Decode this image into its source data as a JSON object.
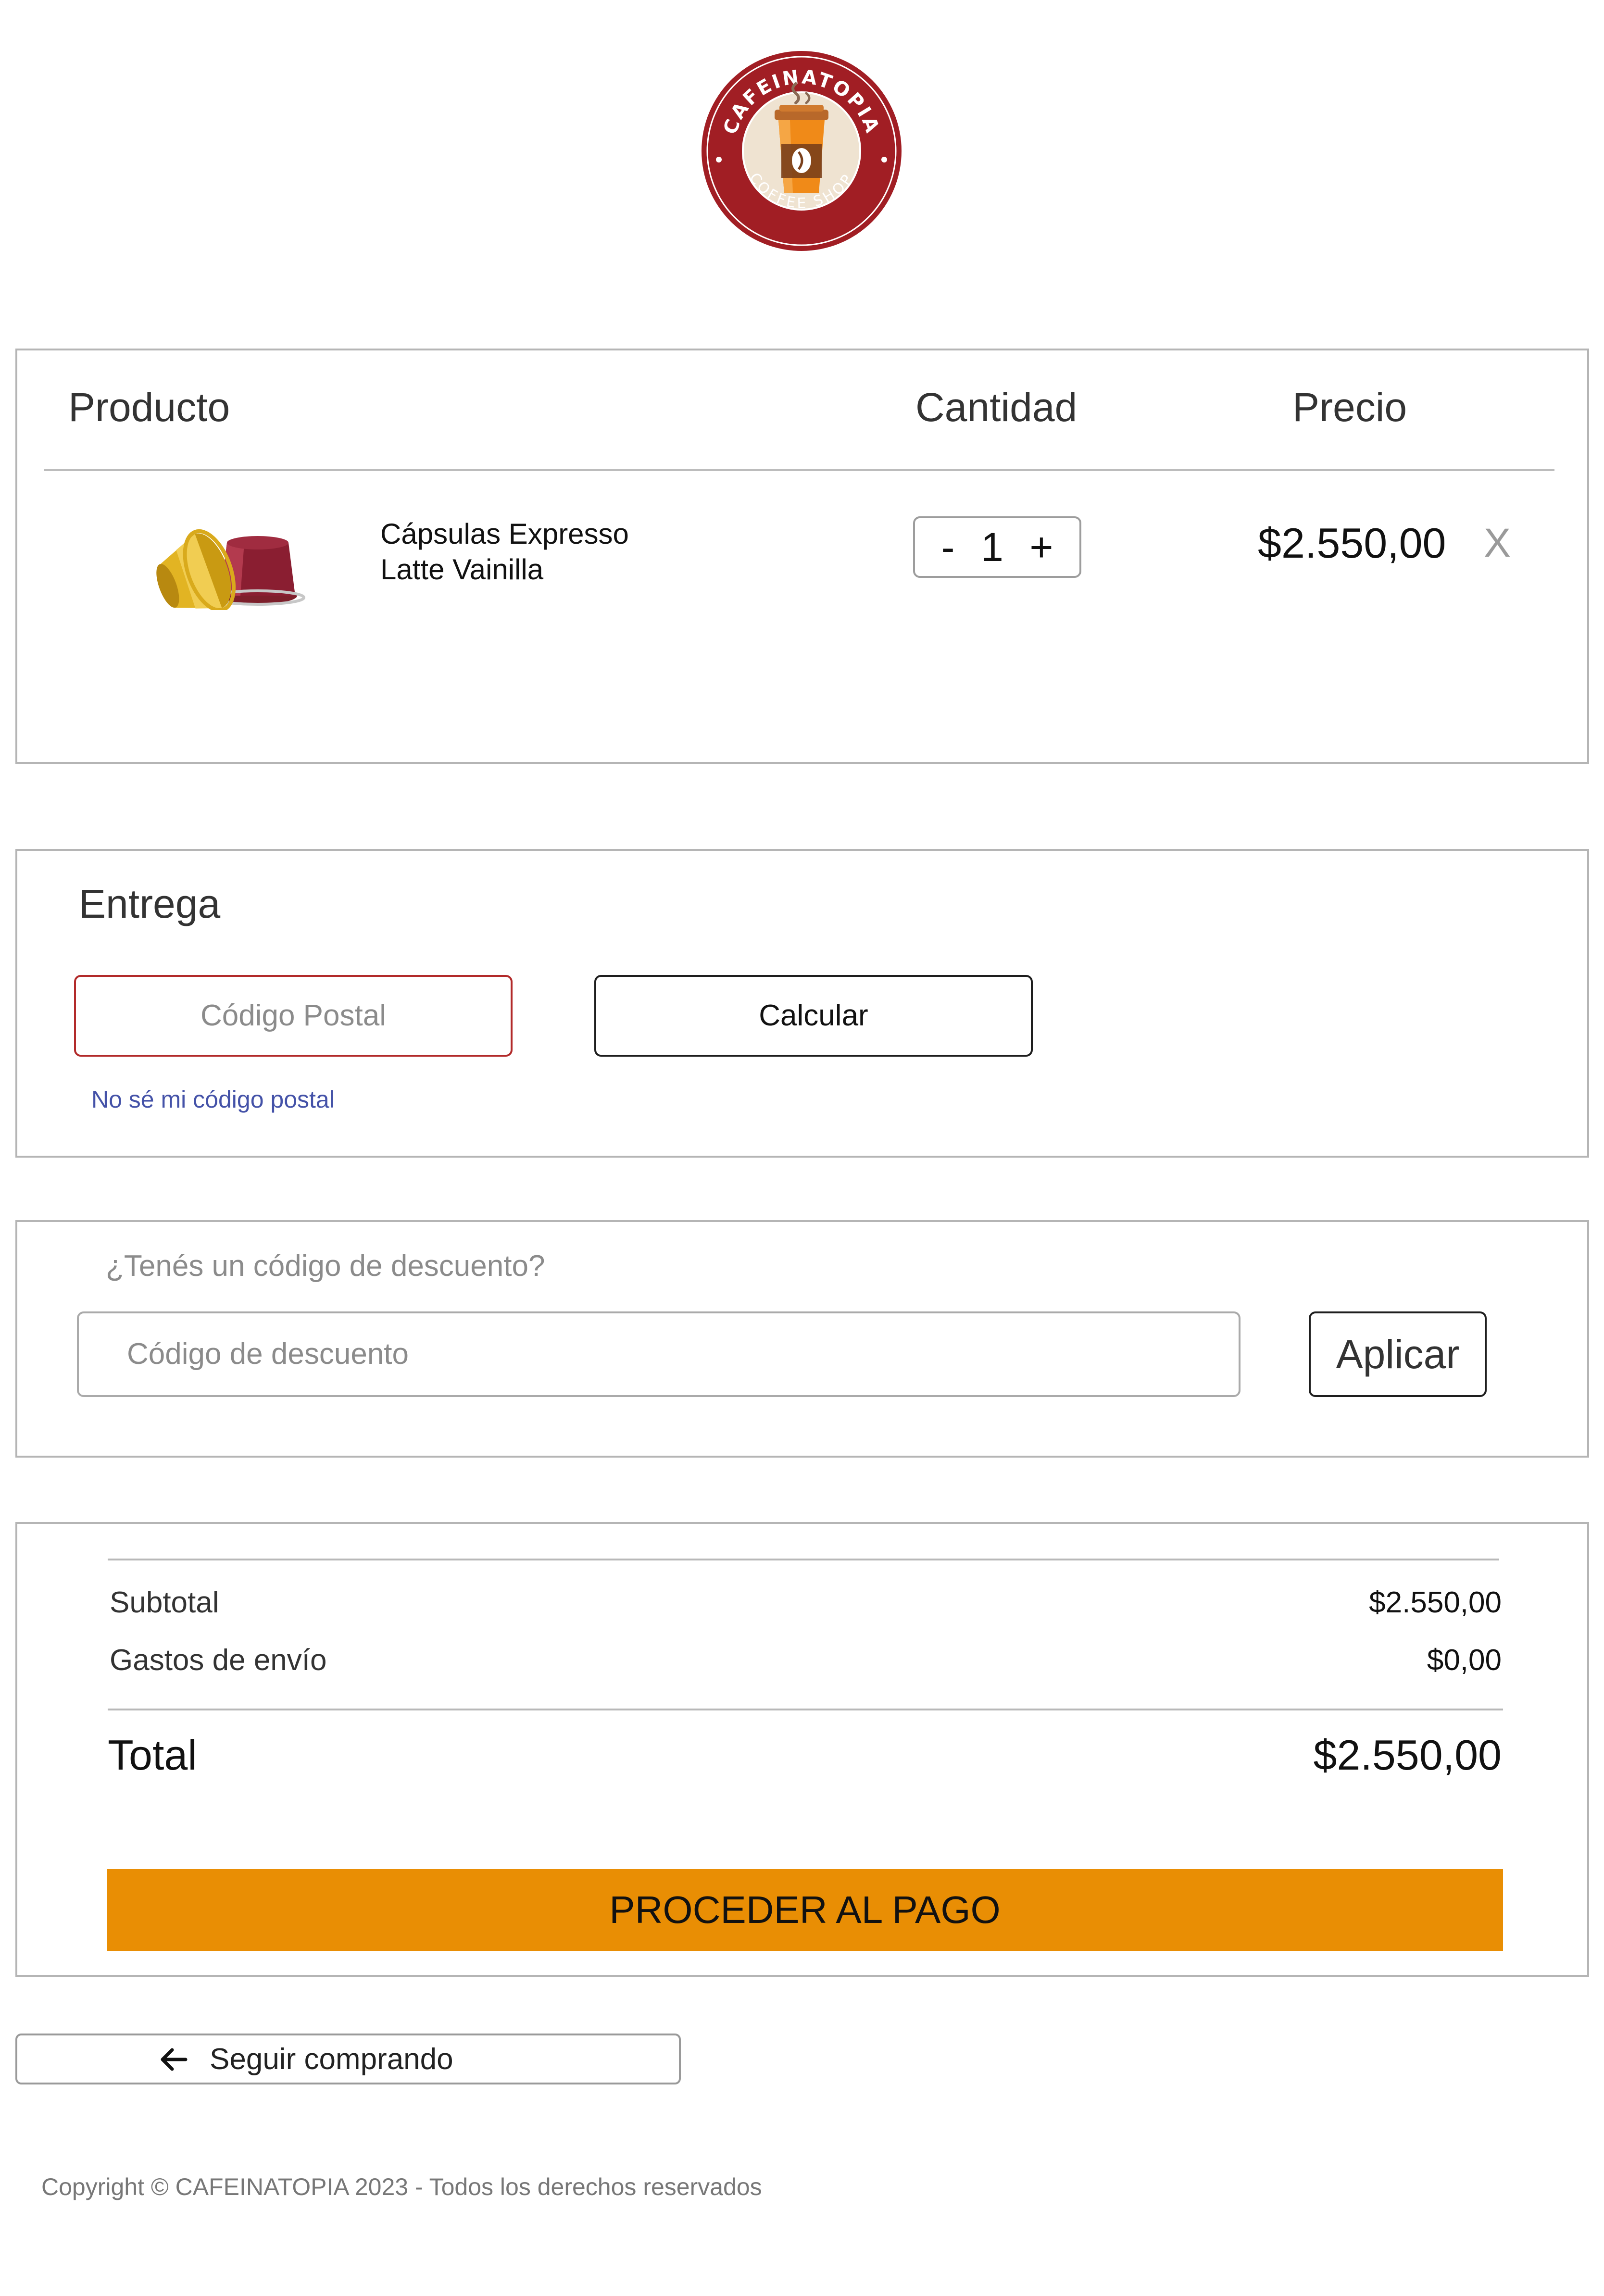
{
  "brand": {
    "name": "CAFEINATOPIA",
    "tagline": "COFFEE SHOP",
    "colors": {
      "ring": "#a11e24",
      "inner": "#efe3d1",
      "cup": "#f08a18",
      "accent": "#e98e04"
    }
  },
  "cart": {
    "headers": {
      "product": "Producto",
      "quantity": "Cantidad",
      "price": "Precio"
    },
    "items": [
      {
        "name_line1": "Cápsulas  Expresso",
        "name_line2": "Latte Vainilla",
        "image_icon": "coffee-capsules-icon",
        "quantity": "1",
        "minus": "-",
        "plus": "+",
        "price": "$2.550,00",
        "remove": "X"
      }
    ]
  },
  "delivery": {
    "title": "Entrega",
    "postal_placeholder": "Código Postal",
    "calc_label": "Calcular",
    "unknown_postal_link": "No sé mi código postal"
  },
  "discount": {
    "question": "¿Tenés un código de descuento?",
    "input_placeholder": "Código de descuento",
    "apply_label": "Aplicar"
  },
  "summary": {
    "subtotal_label": "Subtotal",
    "subtotal_value": "$2.550,00",
    "shipping_label": "Gastos de envío",
    "shipping_value": "$0,00",
    "total_label": "Total",
    "total_value": "$2.550,00",
    "pay_label": "PROCEDER AL PAGO"
  },
  "continue_shopping": {
    "label": "Seguir comprando",
    "icon": "arrow-left-icon"
  },
  "footer": {
    "copyright": "Copyright © CAFEINATOPIA 2023 - Todos los derechos reservados"
  }
}
